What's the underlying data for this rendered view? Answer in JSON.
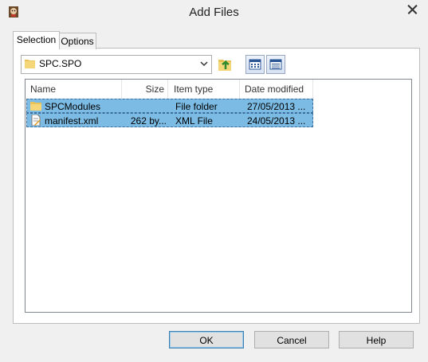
{
  "window": {
    "title": "Add Files"
  },
  "tabs": [
    {
      "label": "Selection",
      "active": true
    },
    {
      "label": "Options",
      "active": false
    }
  ],
  "folder": {
    "current": "SPC.SPO"
  },
  "toolbar": {
    "up_icon": "up-folder-icon",
    "view_icons": [
      "list-view-icon",
      "details-view-icon"
    ]
  },
  "files": {
    "columns": [
      "Name",
      "Size",
      "Item type",
      "Date modified"
    ],
    "rows": [
      {
        "icon": "folder-icon",
        "name": "SPCModules",
        "size": "",
        "type": "File folder",
        "date": "27/05/2013 ..."
      },
      {
        "icon": "xml-file-icon",
        "name": "manifest.xml",
        "size": "262 by...",
        "type": "XML File",
        "date": "24/05/2013 ..."
      }
    ]
  },
  "buttons": {
    "ok": "OK",
    "cancel": "Cancel",
    "help": "Help"
  },
  "colors": {
    "selection": "#7bbbe4",
    "window": "#f0f0f0",
    "primary_border": "#3c7fb1"
  }
}
